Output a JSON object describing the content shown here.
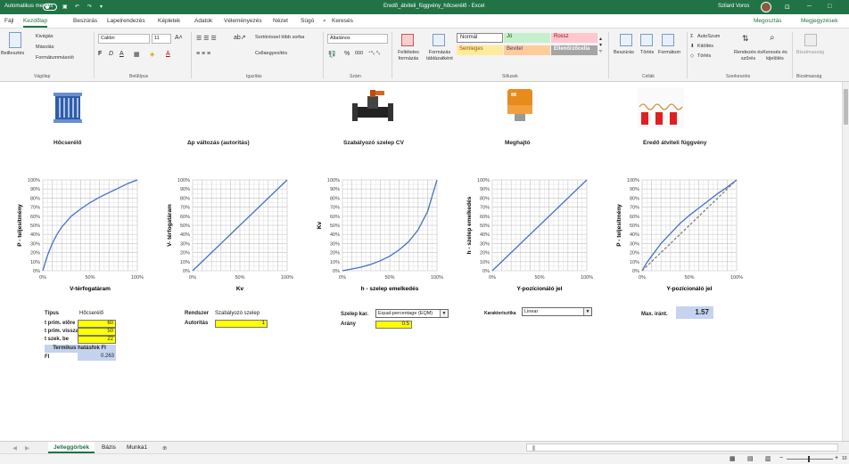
{
  "window": {
    "autosave_label": "Automatikus mentés",
    "title": "Eredő_átviteli_függvény_hőcserélő - Excel",
    "user_name": "Szilard Voros",
    "minimize": "─",
    "maximize": "□",
    "ribbon_mode": "⊡"
  },
  "menu": {
    "tabs": [
      "Fájl",
      "Kezdőlap",
      "Beszúrás",
      "Lapelrendezés",
      "Képletek",
      "Adatok",
      "Véleményezés",
      "Nézet",
      "Súgó"
    ],
    "search": "Keresés",
    "share": "Megosztás",
    "comments": "Megjegyzések"
  },
  "ribbon": {
    "clipboard": {
      "paste": "Beillesztés",
      "cut": "Kivágás",
      "copy": "Másolás",
      "format_painter": "Formátummásoló",
      "label": "Vágólap"
    },
    "font": {
      "name": "Calibri",
      "size": "11",
      "bold": "F",
      "italic": "D",
      "underline": "A",
      "label": "Betűtípus"
    },
    "alignment": {
      "wrap": "Sortöréssel több sorba",
      "merge": "Cellaegyesítés",
      "label": "Igazítás"
    },
    "number": {
      "format": "Általános",
      "pct": "%",
      "thousands": "000",
      "label": "Szám"
    },
    "styles": {
      "conditional": "Feltételes formázás",
      "as_table": "Formázás táblázatként",
      "normal": "Normál",
      "good": "Jó",
      "bad": "Rossz",
      "neutral": "Semleges",
      "input": "Bevitel",
      "check": "Ellenőrzőcella",
      "label": "Stílusok"
    },
    "cells": {
      "insert": "Beszúrás",
      "delete": "Törlés",
      "format": "Formátum",
      "label": "Cellák"
    },
    "editing": {
      "autosum": "AutoSzum",
      "fill": "Kitöltés",
      "clear": "Törlés",
      "sort": "Rendezés és szűrés",
      "find": "Keresés és kijelölés",
      "label": "Szerkesztés"
    },
    "sensitivity": {
      "label": "Bizalmasság",
      "button": "Bizalmasság"
    }
  },
  "components": [
    {
      "title": "Hőcserélő"
    },
    {
      "title": "Δp változás (autoritás)"
    },
    {
      "title": "Szabályozó szelep CV"
    },
    {
      "title": "Meghajtó"
    },
    {
      "title": "Eredő átviteli függvény"
    }
  ],
  "chart_data": [
    {
      "type": "line",
      "xlabel": "V-térfogatáram",
      "ylabel": "P - teljesítmény",
      "xticks": [
        "0%",
        "50%",
        "100%"
      ],
      "yticks": [
        "0%",
        "10%",
        "20%",
        "30%",
        "40%",
        "50%",
        "60%",
        "70%",
        "80%",
        "90%",
        "100%"
      ],
      "xlim": [
        0,
        1
      ],
      "ylim": [
        0,
        1
      ],
      "grid": true,
      "series": [
        {
          "color": "#4472c4",
          "dash": false,
          "x": [
            0,
            0.02,
            0.05,
            0.1,
            0.15,
            0.2,
            0.3,
            0.4,
            0.5,
            0.6,
            0.7,
            0.8,
            0.9,
            1.0
          ],
          "y": [
            0,
            0.07,
            0.17,
            0.3,
            0.4,
            0.48,
            0.6,
            0.68,
            0.75,
            0.81,
            0.86,
            0.91,
            0.96,
            1.0
          ]
        }
      ]
    },
    {
      "type": "line",
      "xlabel": "Kv",
      "ylabel": "V- térfogatáram",
      "xticks": [
        "0%",
        "50%",
        "100%"
      ],
      "yticks": [
        "0%",
        "10%",
        "20%",
        "30%",
        "40%",
        "50%",
        "60%",
        "70%",
        "80%",
        "90%",
        "100%"
      ],
      "xlim": [
        0,
        1
      ],
      "ylim": [
        0,
        1
      ],
      "grid": true,
      "series": [
        {
          "color": "#4472c4",
          "dash": false,
          "x": [
            0,
            1
          ],
          "y": [
            0,
            1
          ]
        }
      ]
    },
    {
      "type": "line",
      "xlabel": "h - szelep emelkedés",
      "ylabel": "Kv",
      "xticks": [
        "0%",
        "50%",
        "100%"
      ],
      "yticks": [
        "0%",
        "10%",
        "20%",
        "30%",
        "40%",
        "50%",
        "60%",
        "70%",
        "80%",
        "90%",
        "100%"
      ],
      "xlim": [
        0,
        1
      ],
      "ylim": [
        0,
        1
      ],
      "grid": true,
      "series": [
        {
          "color": "#4472c4",
          "dash": false,
          "x": [
            0,
            0.1,
            0.2,
            0.3,
            0.4,
            0.5,
            0.6,
            0.7,
            0.8,
            0.9,
            1.0
          ],
          "y": [
            0,
            0.02,
            0.04,
            0.07,
            0.11,
            0.16,
            0.23,
            0.32,
            0.45,
            0.65,
            1.0
          ]
        }
      ]
    },
    {
      "type": "line",
      "xlabel": "Y-pozícionáló jel",
      "ylabel": "h - szelep emelkedés",
      "xticks": [
        "0%",
        "50%",
        "100%"
      ],
      "yticks": [
        "0%",
        "10%",
        "20%",
        "30%",
        "40%",
        "50%",
        "60%",
        "70%",
        "80%",
        "90%",
        "100%"
      ],
      "xlim": [
        0,
        1
      ],
      "ylim": [
        0,
        1
      ],
      "grid": true,
      "series": [
        {
          "color": "#4472c4",
          "dash": false,
          "x": [
            0,
            1
          ],
          "y": [
            0,
            1
          ]
        }
      ]
    },
    {
      "type": "line",
      "xlabel": "Y-pozícionáló jel",
      "ylabel": "P - teljesítmény",
      "xticks": [
        "0%",
        "50%",
        "100%"
      ],
      "yticks": [
        "0%",
        "10%",
        "20%",
        "30%",
        "40%",
        "50%",
        "60%",
        "70%",
        "80%",
        "90%",
        "100%"
      ],
      "xlim": [
        0,
        1
      ],
      "ylim": [
        0,
        1
      ],
      "grid": true,
      "series": [
        {
          "color": "#4472c4",
          "dash": false,
          "x": [
            0,
            0.05,
            0.1,
            0.2,
            0.3,
            0.4,
            0.5,
            0.6,
            0.7,
            0.8,
            0.9,
            1.0
          ],
          "y": [
            0,
            0.09,
            0.16,
            0.3,
            0.41,
            0.52,
            0.61,
            0.69,
            0.77,
            0.85,
            0.92,
            1.0
          ]
        },
        {
          "color": "#7f7f7f",
          "dash": true,
          "x": [
            0,
            1
          ],
          "y": [
            0,
            1
          ]
        }
      ]
    }
  ],
  "params": {
    "hx": {
      "type_label": "Típus",
      "type_value": "Hőcserélő",
      "rows": [
        {
          "label": "t prim. előre",
          "value": "60"
        },
        {
          "label": "t prim. vissza",
          "value": "50"
        },
        {
          "label": "t szek. be",
          "value": "22"
        }
      ],
      "thermal_label": "Termikus hatásfok FI",
      "fi_label": "FI",
      "fi_value": "0.263"
    },
    "sys": {
      "label": "Rendszer",
      "value": "Szabályozó szelep",
      "auth_label": "Autoritás",
      "auth_value": "1"
    },
    "valve": {
      "label": "Szelep kar.",
      "dropdown": "Equal-percentage (EQM)",
      "ratio_label": "Arány",
      "ratio_value": "0.5"
    },
    "actuator": {
      "label": "Karakterisztika",
      "dropdown": "Linear"
    },
    "result": {
      "label": "Max. iránt.",
      "value": "1.57"
    }
  },
  "sheets": {
    "tabs": [
      "Jelleggörbék",
      "Bázis",
      "Munka1"
    ],
    "add": "⊕"
  },
  "status": {
    "zoom_minus": "−",
    "zoom_plus": "+",
    "zoom_label": "10"
  }
}
